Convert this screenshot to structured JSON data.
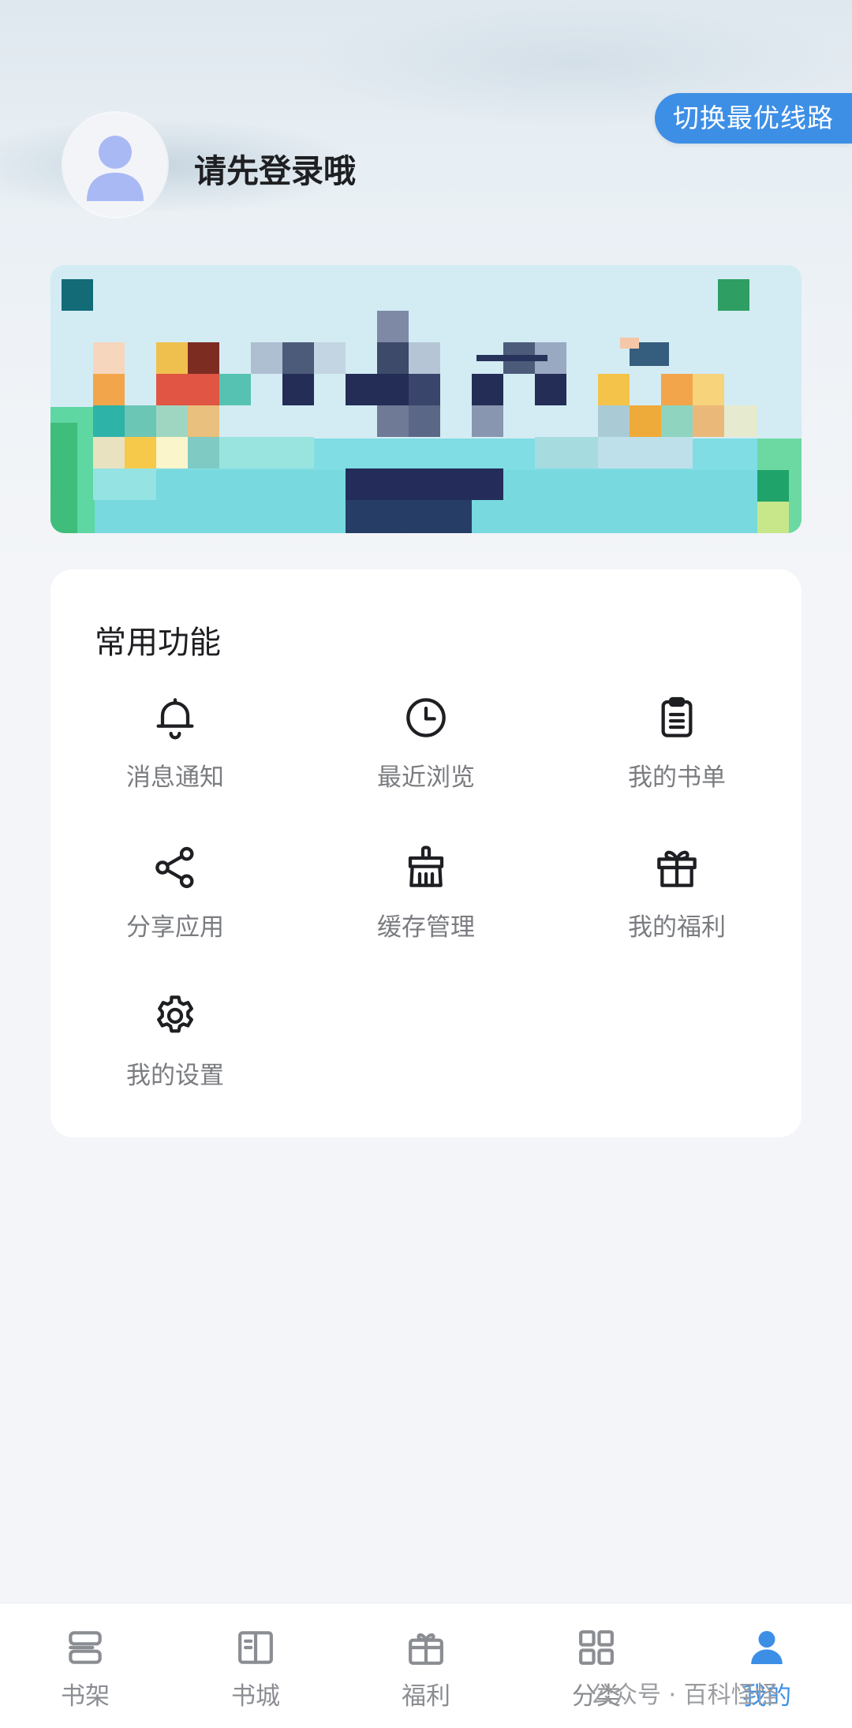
{
  "header": {
    "route_button": "切换最优线路",
    "login_prompt": "请先登录哦"
  },
  "functions": {
    "title": "常用功能",
    "items": [
      {
        "label": "消息通知",
        "icon": "bell-icon"
      },
      {
        "label": "最近浏览",
        "icon": "clock-icon"
      },
      {
        "label": "我的书单",
        "icon": "clipboard-icon"
      },
      {
        "label": "分享应用",
        "icon": "share-icon"
      },
      {
        "label": "缓存管理",
        "icon": "broom-icon"
      },
      {
        "label": "我的福利",
        "icon": "gift-icon"
      },
      {
        "label": "我的设置",
        "icon": "gear-icon"
      }
    ]
  },
  "tabbar": {
    "items": [
      {
        "label": "书架",
        "icon": "bookshelf-icon",
        "active": false
      },
      {
        "label": "书城",
        "icon": "book-icon",
        "active": false
      },
      {
        "label": "福利",
        "icon": "gift-icon",
        "active": false
      },
      {
        "label": "分类",
        "icon": "grid-icon",
        "active": false
      },
      {
        "label": "我的",
        "icon": "person-icon",
        "active": true
      }
    ]
  },
  "watermark": "公众号 · 百科怪怪",
  "colors": {
    "accent": "#3d8fe6",
    "label_gray": "#7a7c80",
    "icon_dark": "#1e1f22"
  }
}
